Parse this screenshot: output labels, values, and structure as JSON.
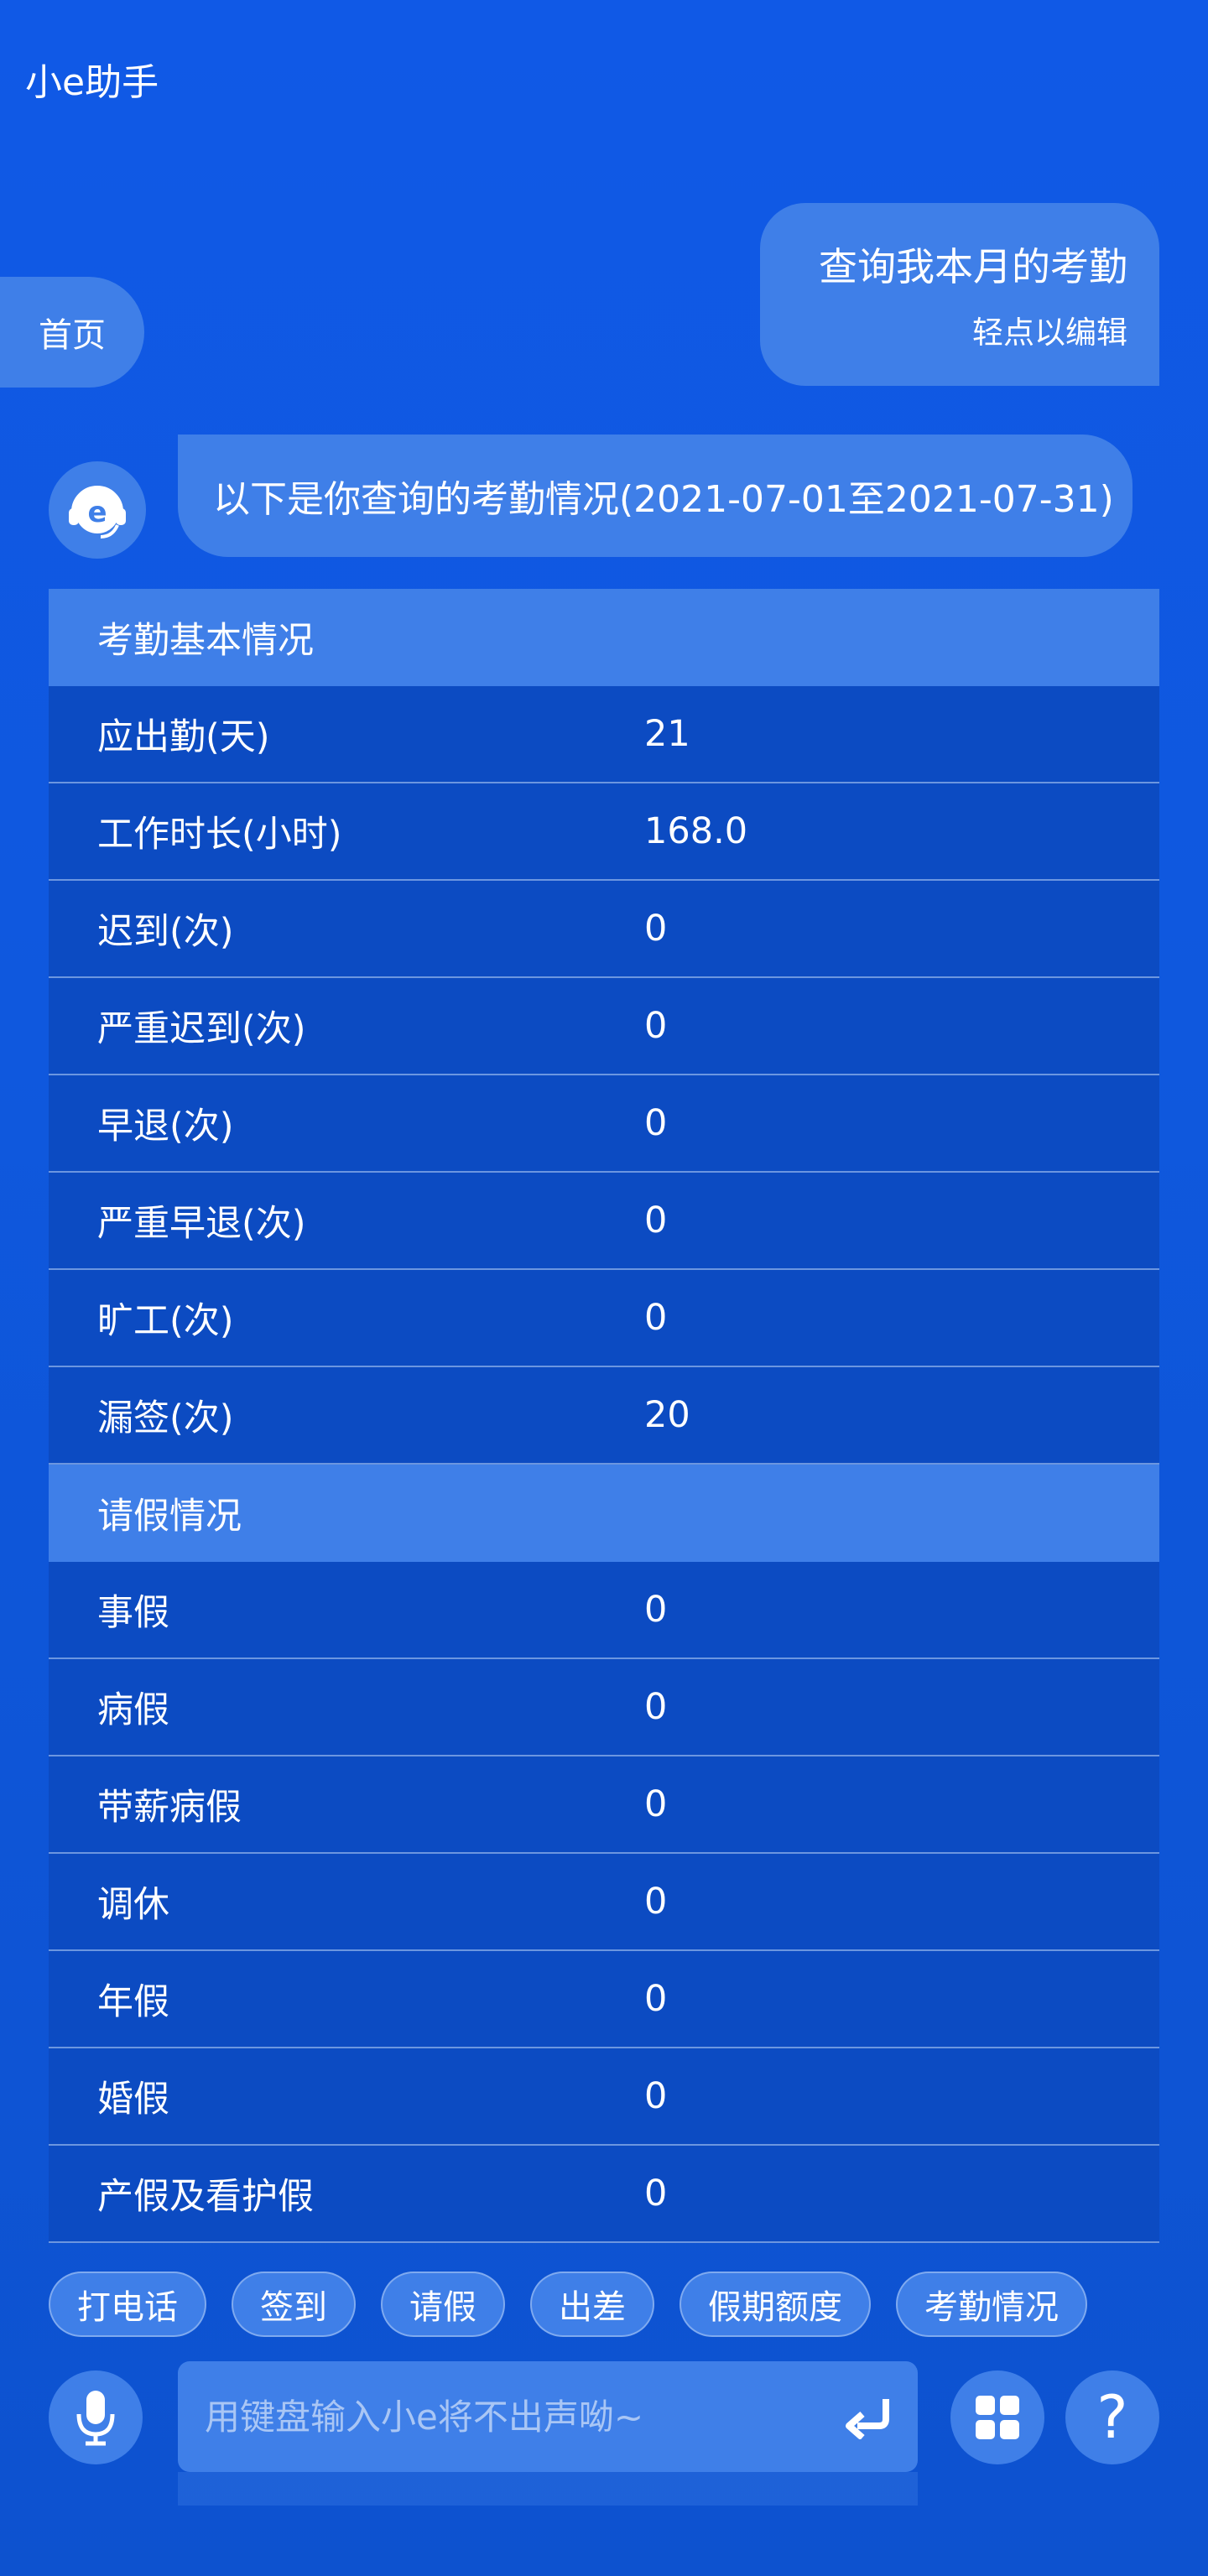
{
  "header": {
    "title": "小e助手"
  },
  "home_tab": {
    "label": "首页"
  },
  "user_message": {
    "text": "查询我本月的考勤",
    "hint": "轻点以编辑"
  },
  "bot_message": {
    "text": "以下是你查询的考勤情况(2021-07-01至2021-07-31)"
  },
  "attendance": {
    "sections": [
      {
        "title": "考勤基本情况",
        "rows": [
          {
            "label": "应出勤(天)",
            "value": "21"
          },
          {
            "label": "工作时长(小时)",
            "value": "168.0"
          },
          {
            "label": "迟到(次)",
            "value": "0"
          },
          {
            "label": "严重迟到(次)",
            "value": "0"
          },
          {
            "label": "早退(次)",
            "value": "0"
          },
          {
            "label": "严重早退(次)",
            "value": "0"
          },
          {
            "label": "旷工(次)",
            "value": "0"
          },
          {
            "label": "漏签(次)",
            "value": "20"
          }
        ]
      },
      {
        "title": "请假情况",
        "rows": [
          {
            "label": "事假",
            "value": "0"
          },
          {
            "label": "病假",
            "value": "0"
          },
          {
            "label": "带薪病假",
            "value": "0"
          },
          {
            "label": "调休",
            "value": "0"
          },
          {
            "label": "年假",
            "value": "0"
          },
          {
            "label": "婚假",
            "value": "0"
          },
          {
            "label": "产假及看护假",
            "value": "0"
          }
        ]
      }
    ]
  },
  "quick_actions": [
    "打电话",
    "签到",
    "请假",
    "出差",
    "假期额度",
    "考勤情况"
  ],
  "input": {
    "placeholder": "用键盘输入小e将不出声呦~"
  },
  "icons": {
    "avatar": "headset-e-icon",
    "mic": "microphone-icon",
    "send": "return-arrow-icon",
    "apps": "grid-icon",
    "help": "question-mark-icon"
  },
  "colors": {
    "background": "#1059e6",
    "bubble": "#3f7fe8",
    "table_row": "#0c4bc2"
  }
}
